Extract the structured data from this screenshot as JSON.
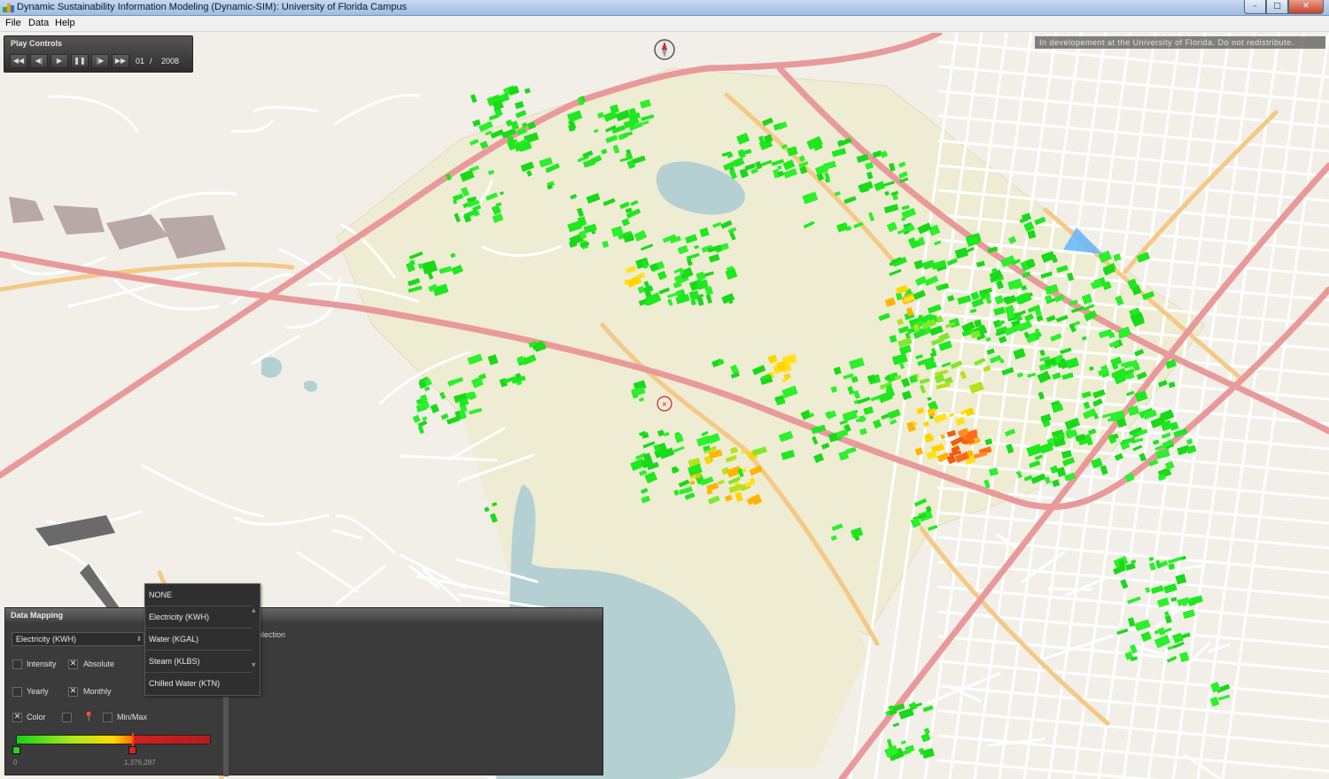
{
  "window": {
    "title": "Dynamic Sustainability Information Modeling (Dynamic-SIM): University of Florida Campus",
    "buttons": {
      "minimize": "–",
      "maximize": "□",
      "close": "✕"
    }
  },
  "menu": {
    "file": "File",
    "data": "Data",
    "help": "Help"
  },
  "watermark": "In developement at the University of Florida.  Do not redistribute.",
  "play_controls": {
    "title": "Play Controls",
    "buttons": [
      {
        "name": "rewind-button",
        "icon": "rewind-icon",
        "glyph": "◀◀"
      },
      {
        "name": "step-back-button",
        "icon": "step-back-icon",
        "glyph": "◀|"
      },
      {
        "name": "play-button",
        "icon": "play-icon",
        "glyph": "▶"
      },
      {
        "name": "pause-button",
        "icon": "pause-icon",
        "glyph": "❚❚"
      },
      {
        "name": "step-forward-button",
        "icon": "step-forward-icon",
        "glyph": "|▶"
      },
      {
        "name": "fast-forward-button",
        "icon": "fast-forward-icon",
        "glyph": "▶▶"
      }
    ],
    "month": "01",
    "separator": "/",
    "year": "2008"
  },
  "data_mapping": {
    "title": "Data Mapping",
    "selected": "Electricity (KWH)",
    "selection_label": "election",
    "options": {
      "intensity": {
        "label": "Intensity",
        "checked": false
      },
      "absolute": {
        "label": "Absolute",
        "checked": true
      },
      "yearly": {
        "label": "Yearly",
        "checked": false
      },
      "monthly": {
        "label": "Monthly",
        "checked": true
      },
      "color": {
        "label": "Color",
        "checked": true
      },
      "pin": {
        "checked": false
      },
      "minmax": {
        "label": "Min/Max",
        "checked": false
      }
    },
    "scale": {
      "min": "0",
      "max": "1,376,287",
      "threshold_fraction": 0.6
    },
    "check_glyph": "✕"
  },
  "dropdown": {
    "items": [
      "NONE",
      "Electricity (KWH)",
      "Water (KGAL)",
      "Steam (KLBS)",
      "Chilled Water (KTN)"
    ]
  },
  "colors": {
    "road_major": "#e89a9a",
    "road_secondary": "#f4c987",
    "road_minor": "#ffffff",
    "campus_area": "#efecd4",
    "water": "#b4d0d2",
    "building_low": "#1ee81e",
    "building_mid": "#ffd500",
    "building_high": "#ff6a1a"
  }
}
